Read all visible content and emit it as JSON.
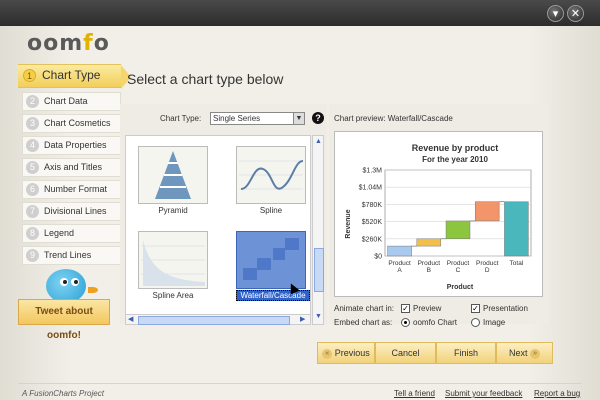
{
  "logo": {
    "text_a": "oom",
    "text_b": "f",
    "text_c": "o"
  },
  "sidebar": {
    "active": {
      "number": "1",
      "label": "Chart Type"
    },
    "items": [
      {
        "number": "2",
        "label": "Chart Data"
      },
      {
        "number": "3",
        "label": "Chart Cosmetics"
      },
      {
        "number": "4",
        "label": "Data Properties"
      },
      {
        "number": "5",
        "label": "Axis and Titles"
      },
      {
        "number": "6",
        "label": "Number Format"
      },
      {
        "number": "7",
        "label": "Divisional Lines"
      },
      {
        "number": "8",
        "label": "Legend"
      },
      {
        "number": "9",
        "label": "Trend Lines"
      }
    ],
    "tweet_label": "Tweet about oomfo!"
  },
  "main": {
    "title": "Select a chart type below"
  },
  "chart_type": {
    "label": "Chart Type:",
    "selected": "Single Series",
    "help_icon": "?",
    "thumbnails": [
      {
        "label": "Pyramid",
        "icon": "pyramid-chart-icon"
      },
      {
        "label": "Spline",
        "icon": "spline-chart-icon"
      },
      {
        "label": "Spline Area",
        "icon": "spline-area-chart-icon"
      },
      {
        "label": "Waterfall/Cascade",
        "icon": "waterfall-chart-icon",
        "selected": true
      }
    ]
  },
  "preview": {
    "label": "Chart preview: Waterfall/Cascade",
    "animate_label": "Animate chart in:",
    "animate_options": [
      {
        "label": "Preview",
        "checked": true
      },
      {
        "label": "Presentation",
        "checked": true
      }
    ],
    "embed_label": "Embed chart as:",
    "embed_options": [
      {
        "label": "oomfo Chart",
        "selected": true
      },
      {
        "label": "Image",
        "selected": false
      }
    ]
  },
  "chart_data": {
    "type": "bar",
    "title": "Revenue by product",
    "subtitle": "For the year 2010",
    "xlabel": "Product",
    "ylabel": "Revenue",
    "categories": [
      "Product A",
      "Product B",
      "Product C",
      "Product D",
      "Total"
    ],
    "category_lines": [
      [
        "Product",
        "A"
      ],
      [
        "Product",
        "B"
      ],
      [
        "Product",
        "C"
      ],
      [
        "Product",
        "D"
      ],
      [
        "Total"
      ]
    ],
    "waterfall": true,
    "start": [
      0,
      150000,
      260000,
      530000,
      0
    ],
    "end": [
      150000,
      260000,
      530000,
      820000,
      820000
    ],
    "colors": [
      "#a9c9ee",
      "#f2c04a",
      "#8cc63f",
      "#f2956a",
      "#4ab7bd"
    ],
    "ylim": [
      0,
      1300000
    ],
    "yticks": [
      0,
      260000,
      520000,
      780000,
      1040000,
      1300000
    ],
    "ytick_labels": [
      "$0",
      "$260K",
      "$520K",
      "$780K",
      "$1.04M",
      "$1.3M"
    ]
  },
  "nav": {
    "previous": "Previous",
    "cancel": "Cancel",
    "finish": "Finish",
    "next": "Next",
    "prev_arrow": "«",
    "next_arrow": "»"
  },
  "footer": {
    "credit": "A FusionCharts Project",
    "links": [
      "Tell a friend",
      "Submit your feedback",
      "Report a bug"
    ]
  },
  "window": {
    "minimize": "▾",
    "close": "✕"
  }
}
